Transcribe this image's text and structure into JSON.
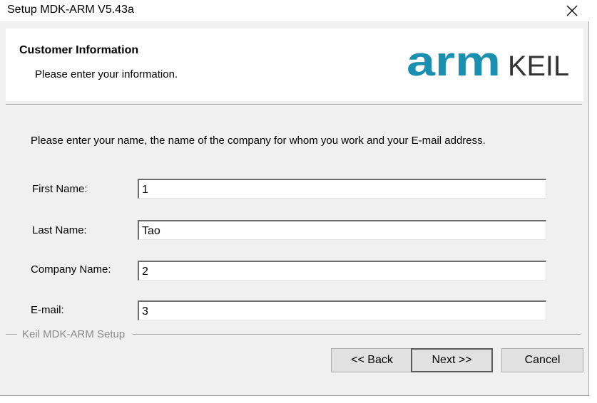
{
  "window": {
    "title": "Setup MDK-ARM V5.43a"
  },
  "header": {
    "title": "Customer Information",
    "subtitle": "Please enter your information.",
    "logo_arm": "arm",
    "logo_keil": "KEIL",
    "logo_color": "#1b8fb0"
  },
  "intro": "Please enter your name, the name of the company for whom you work and your E-mail address.",
  "fields": [
    {
      "label": "First Name:",
      "value": "1"
    },
    {
      "label": "Last Name:",
      "value": "Tao"
    },
    {
      "label": "Company Name:",
      "value": "2"
    },
    {
      "label": "E-mail:",
      "value": "3"
    }
  ],
  "group_label": "Keil MDK-ARM Setup",
  "buttons": {
    "back": "<< Back",
    "next": "Next >>",
    "cancel": "Cancel"
  },
  "icons": {
    "close": "close-icon"
  }
}
